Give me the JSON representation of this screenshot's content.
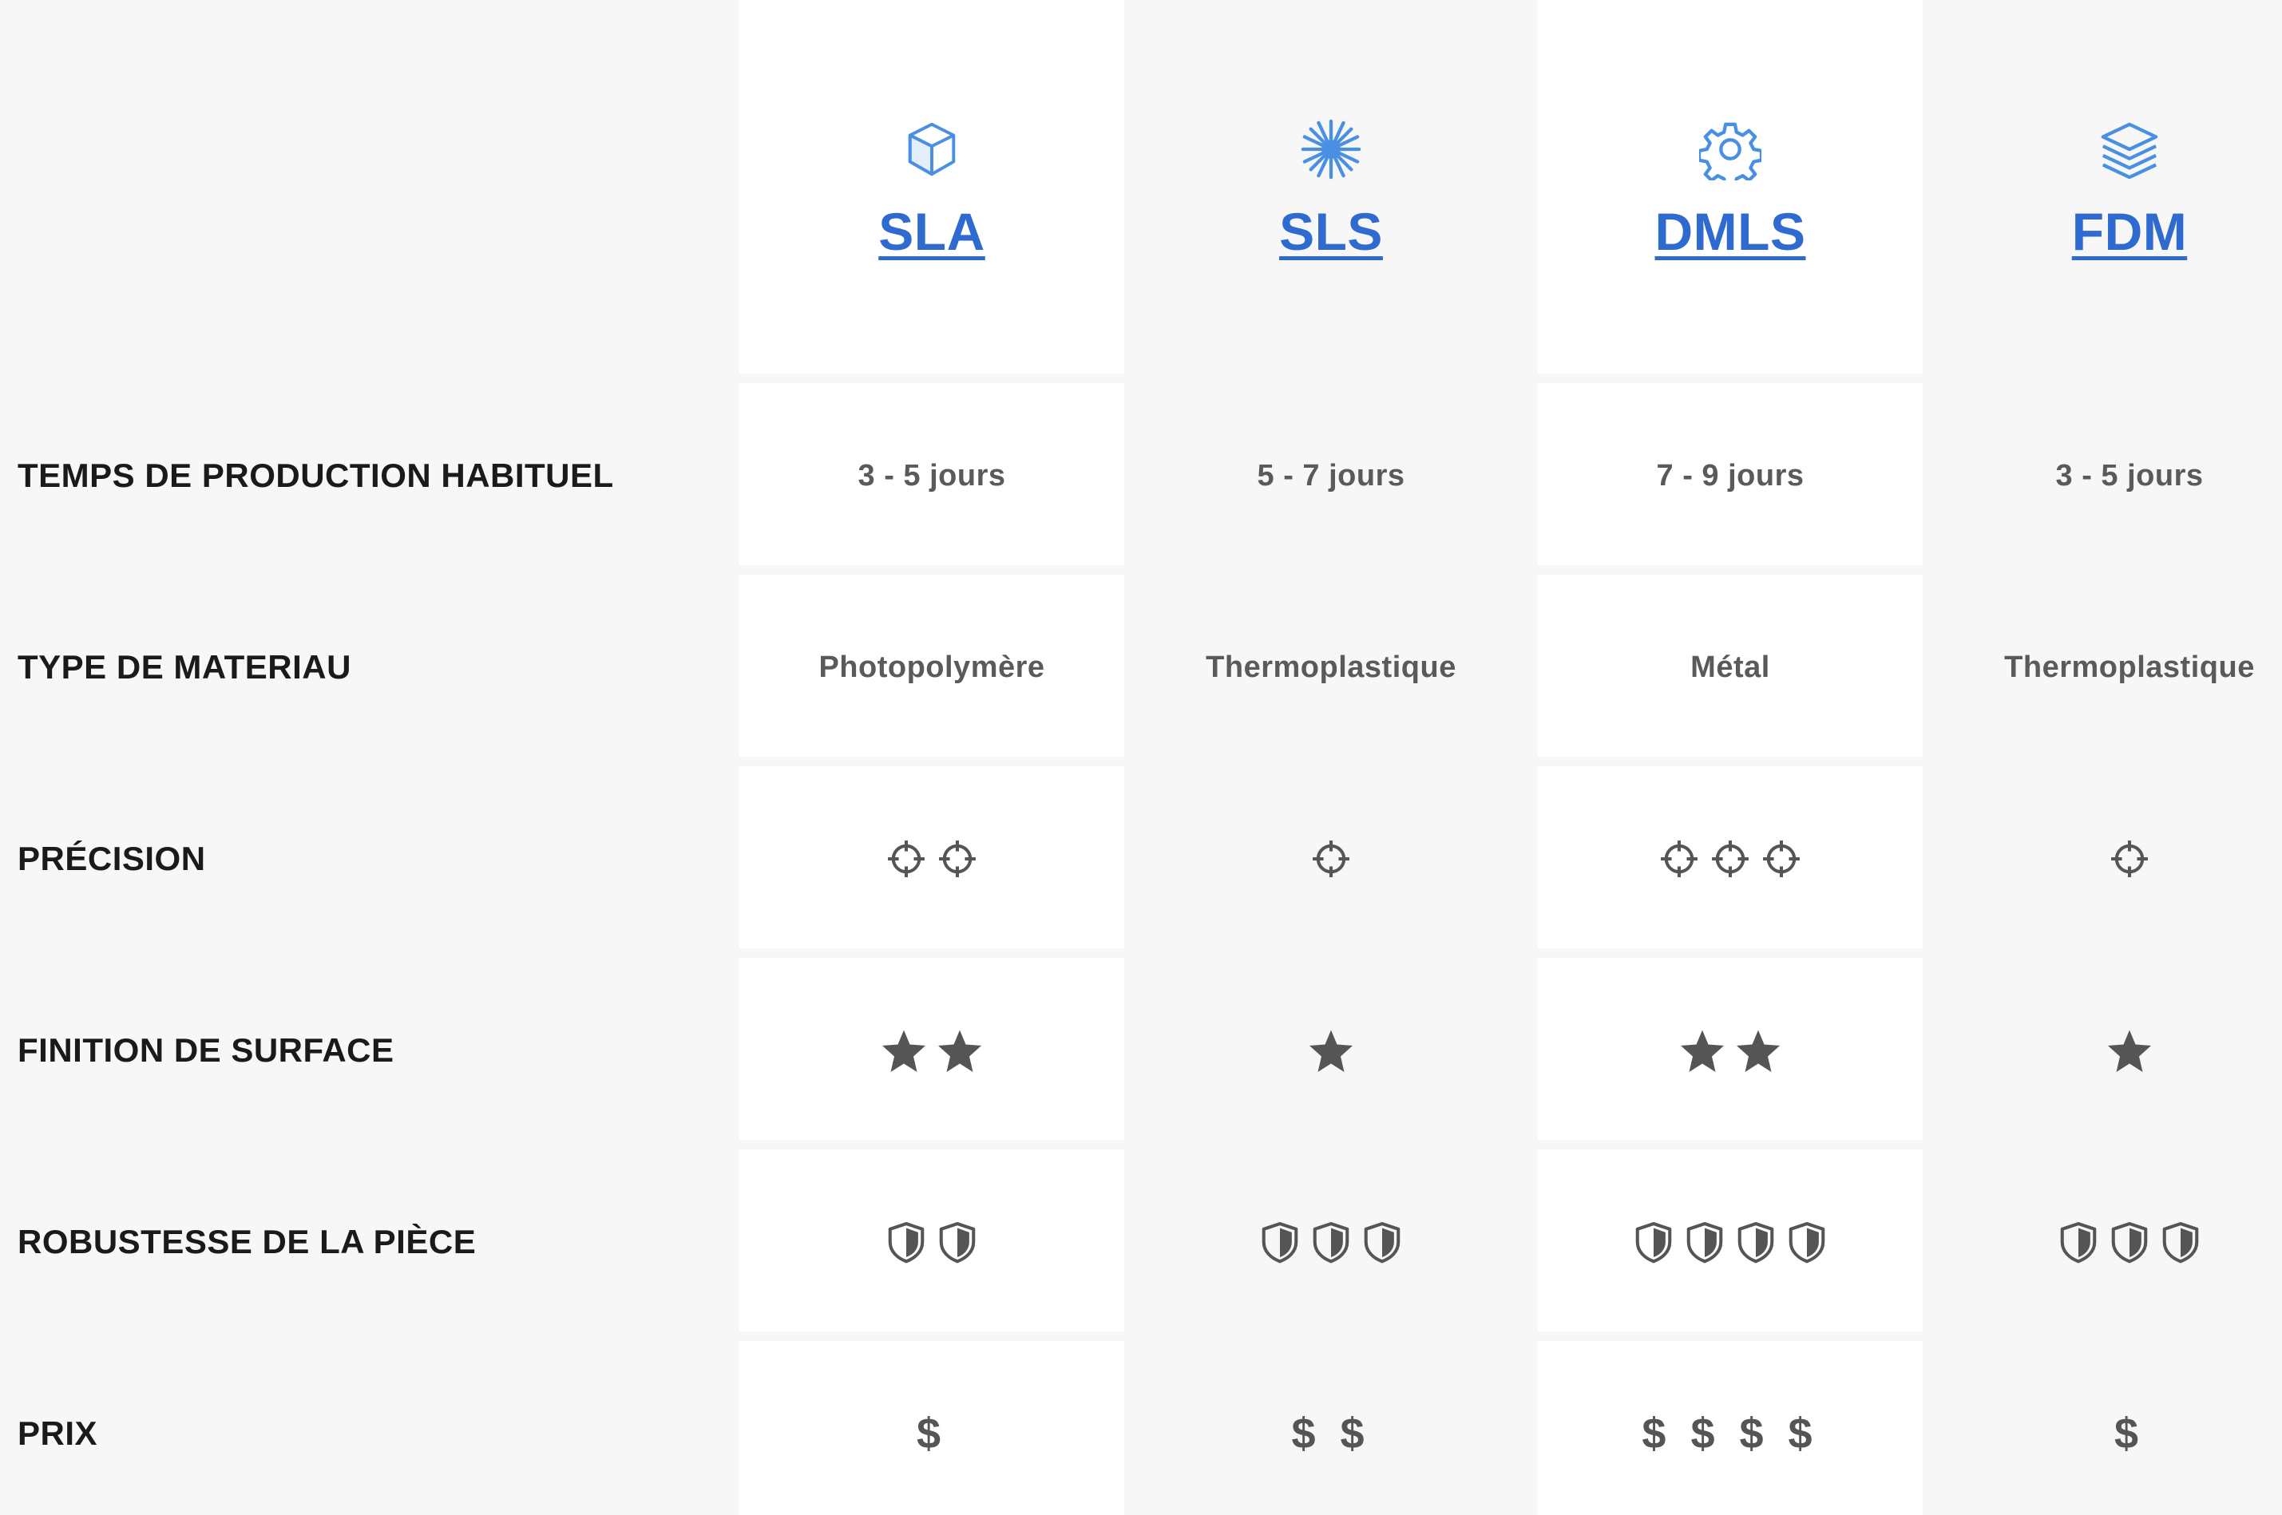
{
  "technologies": [
    {
      "name": "SLA",
      "icon": "cube-icon"
    },
    {
      "name": "SLS",
      "icon": "laser-burst-icon"
    },
    {
      "name": "DMLS",
      "icon": "gear-icon"
    },
    {
      "name": "FDM",
      "icon": "layers-icon"
    }
  ],
  "rows": {
    "production_time": {
      "label": "TEMPS DE PRODUCTION HABITUEL",
      "values": [
        "3 - 5 jours",
        "5 - 7 jours",
        "7 - 9 jours",
        "3 - 5 jours"
      ]
    },
    "material_type": {
      "label": "TYPE DE MATERIAU",
      "values": [
        "Photopolymère",
        "Thermoplastique",
        "Métal",
        "Thermoplastique"
      ]
    },
    "precision": {
      "label": "PRÉCISION",
      "icon": "crosshair-icon",
      "values": [
        2,
        1,
        3,
        1
      ]
    },
    "surface_finish": {
      "label": "FINITION DE SURFACE",
      "icon": "star-icon",
      "values": [
        2,
        1,
        2,
        1
      ]
    },
    "part_strength": {
      "label": "ROBUSTESSE DE LA PIÈCE",
      "icon": "shield-icon",
      "values": [
        2,
        3,
        4,
        3
      ]
    },
    "price": {
      "label": "PRIX",
      "values": [
        "$",
        "$ $",
        "$ $ $ $",
        "$"
      ]
    }
  },
  "colors": {
    "link_blue": "#2f6ad0",
    "icon_blue": "#4a90e2",
    "text_gray": "#5a5a5a",
    "label_dark": "#1a1a1a",
    "glyph_gray": "#555555"
  }
}
